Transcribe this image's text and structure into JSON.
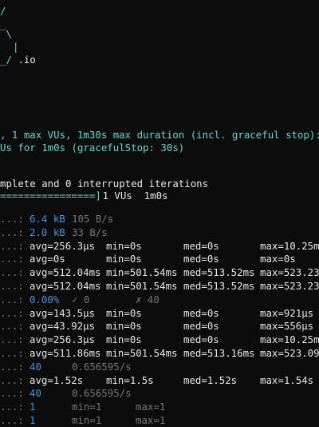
{
  "terminal": {
    "background": "#0c0c0c",
    "accent": "#3a96dd",
    "logo": {
      "line1": "/",
      "line2": "‾\\",
      "line3": "|",
      "line4_mark": "_/",
      "line4_text": " .io"
    },
    "scenario": {
      "line1": ", 1 max VUs, 1m30s max duration (incl. graceful stop):",
      "line2": "Us for 1m0s (gracefulStop: 30s)"
    },
    "summary": {
      "iterations_line": "mplete and 0 interrupted iterations",
      "progress_bar": "================]",
      "progress_status": " 1 VUs  1m0s"
    },
    "metric_prefix": "...:",
    "metrics": [
      {
        "kind": "rate",
        "value": "6.4 kB",
        "rate": "105 B/s"
      },
      {
        "kind": "rate",
        "value": "2.0 kB",
        "rate": "33 B/s"
      },
      {
        "kind": "trend",
        "avg": "avg=256.3µs",
        "min": "min=0s",
        "med": "med=0s",
        "max": "max=10.25m"
      },
      {
        "kind": "trend",
        "avg": "avg=0s",
        "min": "min=0s",
        "med": "med=0s",
        "max": "max=0s"
      },
      {
        "kind": "trend",
        "avg": "avg=512.04ms",
        "min": "min=501.54ms",
        "med": "med=513.52ms",
        "max": "max=523.23"
      },
      {
        "kind": "trend",
        "avg": "avg=512.04ms",
        "min": "min=501.54ms",
        "med": "med=513.52ms",
        "max": "max=523.23"
      },
      {
        "kind": "check",
        "value": "0.00%",
        "pass": "✓ 0",
        "fail": "✗ 40"
      },
      {
        "kind": "trend",
        "avg": "avg=143.5µs",
        "min": "min=0s",
        "med": "med=0s",
        "max": "max=921µs"
      },
      {
        "kind": "trend",
        "avg": "avg=43.92µs",
        "min": "min=0s",
        "med": "med=0s",
        "max": "max=556µs"
      },
      {
        "kind": "trend",
        "avg": "avg=256.3µs",
        "min": "min=0s",
        "med": "med=0s",
        "max": "max=10.25m"
      },
      {
        "kind": "trend",
        "avg": "avg=511.86ms",
        "min": "min=501.54ms",
        "med": "med=513.16ms",
        "max": "max=523.09"
      },
      {
        "kind": "rate",
        "value": "40",
        "rate": "0.656595/s"
      },
      {
        "kind": "trend",
        "avg": "avg=1.52s",
        "min": "min=1.5s",
        "med": "med=1.52s",
        "max": "max=1.54s"
      },
      {
        "kind": "rate",
        "value": "40",
        "rate": "0.656595/s"
      },
      {
        "kind": "gauge",
        "value": "1",
        "min": "min=1",
        "max": "max=1"
      },
      {
        "kind": "gauge",
        "value": "1",
        "min": "min=1",
        "max": "max=1"
      }
    ]
  }
}
